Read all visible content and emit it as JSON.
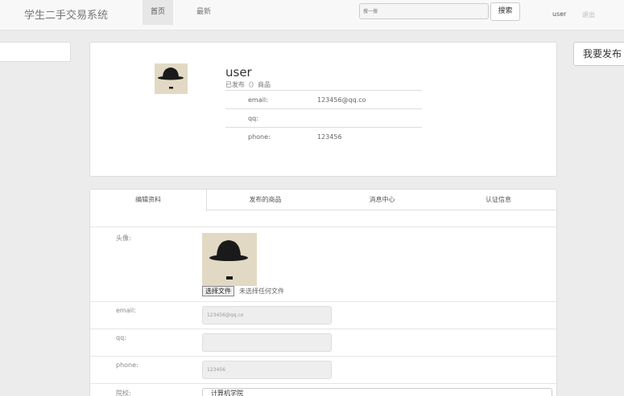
{
  "nav": {
    "brand": "学生二手交易系统",
    "home": "首页",
    "latest": "最新",
    "search_placeholder": "搜一搜",
    "search_button": "搜索",
    "user": "user",
    "logout": "退出"
  },
  "publish_button": "我要发布",
  "profile": {
    "name": "user",
    "subtitle": "已发布（）商品",
    "rows": [
      {
        "key": "email:",
        "value": "123456@qq.co"
      },
      {
        "key": "qq:",
        "value": ""
      },
      {
        "key": "phone:",
        "value": "123456"
      }
    ]
  },
  "tabs": [
    "编辑资料",
    "发布的商品",
    "消息中心",
    "认证信息"
  ],
  "form": {
    "avatar_label": "头像:",
    "file_button": "选择文件",
    "file_status": "未选择任何文件",
    "email_label": "email:",
    "email_value": "123456@qq.co",
    "qq_label": "qq:",
    "qq_value": "",
    "phone_label": "phone:",
    "phone_value": "123456",
    "college_label": "院校:",
    "college_value": "计算机学院"
  },
  "colors": {
    "background": "#ececec",
    "panel": "#ffffff",
    "avatar_bg": "#e2d9c4"
  }
}
